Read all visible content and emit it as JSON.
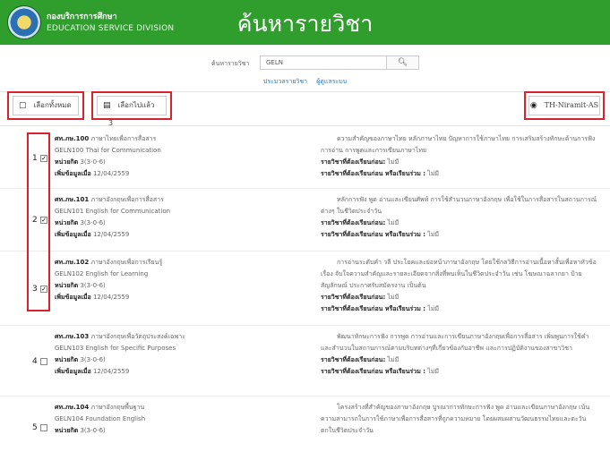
{
  "header": {
    "org_th": "กองบริการการศึกษา",
    "org_en": "EDUCATION SERVICE DIVISION",
    "title": "ค้นหารายวิชา"
  },
  "search": {
    "label": "ค้นหารายวิชา",
    "value": "GELN",
    "button_icon": "search-icon",
    "links": [
      "ประมวลรายวิชา",
      "ผู้ดูแลระบบ"
    ]
  },
  "toolbar": {
    "select_all_label": "เลือกทั้งหมด",
    "selected_label": "เลือกไปแล้ว",
    "selected_count": "3",
    "font_label": "TH-Niramit-AS"
  },
  "courses": [
    {
      "num": "1",
      "checked": true,
      "title_code": "ศท.ภษ.100",
      "title_th": "ภาษาไทยเพื่อการสื่อสาร",
      "name_en": "GELN100 Thai for Communication",
      "credit_label": "หน่วยกิต",
      "credit": "3(3-0-6)",
      "added_label": "เพิ่มข้อมูลเมื่อ",
      "added": "12/04/2559",
      "desc": "ความสำคัญของภาษาไทย หลักภาษาไทย ปัญหาการใช้ภาษาไทย การเสริมสร้างทักษะด้านการฟัง การอ่าน การพูดและการเขียนภาษาไทย",
      "prereq_label": "รายวิชาที่ต้องเรียนก่อน:",
      "prereq": "ไม่มี",
      "coreq_label": "รายวิชาที่ต้องเรียนก่อน หรือเรียนร่วม :",
      "coreq": "ไม่มี"
    },
    {
      "num": "2",
      "checked": true,
      "title_code": "ศท.ภษ.101",
      "title_th": "ภาษาอังกฤษเพื่อการสื่อสาร",
      "name_en": "GELN101 English for Communication",
      "credit_label": "หน่วยกิต",
      "credit": "3(3-0-6)",
      "added_label": "เพิ่มข้อมูลเมื่อ",
      "added": "12/04/2559",
      "desc": "หลักการฟัง พูด อ่านและเขียนศัพท์ การใช้สำนวนภาษาอังกฤษ เพื่อใช้ในการสื่อสารในสถานการณ์ต่างๆ ในชีวิตประจำวัน",
      "prereq_label": "รายวิชาที่ต้องเรียนก่อน:",
      "prereq": "ไม่มี",
      "coreq_label": "รายวิชาที่ต้องเรียนก่อน หรือเรียนร่วม :",
      "coreq": "ไม่มี"
    },
    {
      "num": "3",
      "checked": true,
      "title_code": "ศท.ภษ.102",
      "title_th": "ภาษาอังกฤษเพื่อการเรียนรู้",
      "name_en": "GELN102 English for Learning",
      "credit_label": "หน่วยกิต",
      "credit": "3(3-0-6)",
      "added_label": "เพิ่มข้อมูลเมื่อ",
      "added": "12/04/2559",
      "desc": "การอ่านระดับคำ วลี ประโยคและย่อหน้าภาษาอังกฤษ โดยใช้กลวิธีการอ่านเนื้อหาสั้นเพื่อหาหัวข้อเรื่อง จับใจความสำคัญและรายละเอียดจากสิ่งที่พบเห็นในชีวิตประจำวัน เช่น โฆษณาฉลากยา ป้ายสัญลักษณ์ ประกาศรับสมัครงาน เป็นต้น",
      "prereq_label": "รายวิชาที่ต้องเรียนก่อน:",
      "prereq": "ไม่มี",
      "coreq_label": "รายวิชาที่ต้องเรียนก่อน หรือเรียนร่วม :",
      "coreq": "ไม่มี"
    },
    {
      "num": "4",
      "checked": false,
      "title_code": "ศท.ภษ.103",
      "title_th": "ภาษาอังกฤษเพื่อวัตถุประสงค์เฉพาะ",
      "name_en": "GELN103 English for Specific Purposes",
      "credit_label": "หน่วยกิต",
      "credit": "3(3-0-6)",
      "added_label": "เพิ่มข้อมูลเมื่อ",
      "added": "12/04/2559",
      "desc": "พัฒนาทักษะการฟัง การพูด การอ่านและการเขียนภาษาอังกฤษเพื่อการสื่อสาร เพิ่มพูนการใช้คำ และสำนวนในสถานการณ์ตามบริบทต่างๆที่เกี่ยวข้องกับอาชีพ และการปฏิบัติงานของสาขาวิชา",
      "prereq_label": "รายวิชาที่ต้องเรียนก่อน:",
      "prereq": "ไม่มี",
      "coreq_label": "รายวิชาที่ต้องเรียนก่อน หรือเรียนร่วม :",
      "coreq": "ไม่มี"
    },
    {
      "num": "5",
      "checked": false,
      "title_code": "ศท.ภษ.104",
      "title_th": "ภาษาอังกฤษพื้นฐาน",
      "name_en": "GELN104 Foundation English",
      "credit_label": "หน่วยกิต",
      "credit": "3(3-0-6)",
      "added_label": "",
      "added": "",
      "desc": "โครงสร้างที่สำคัญของภาษาอังกฤษ บูรณาการทักษะการฟัง พูด อ่านและเขียนภาษาอังกฤษ เน้นความสามารถในการใช้ภาษาเพื่อการสื่อสารที่ถูกความหมาย โดยผสมผสานวัฒนธรรมไทยและตะวันตกในชีวิตประจำวัน",
      "prereq_label": "",
      "prereq": "",
      "coreq_label": "",
      "coreq": ""
    }
  ],
  "colors": {
    "header_bg": "#2f9e2d",
    "highlight_border": "#d9232a",
    "link": "#2a7ab8"
  }
}
